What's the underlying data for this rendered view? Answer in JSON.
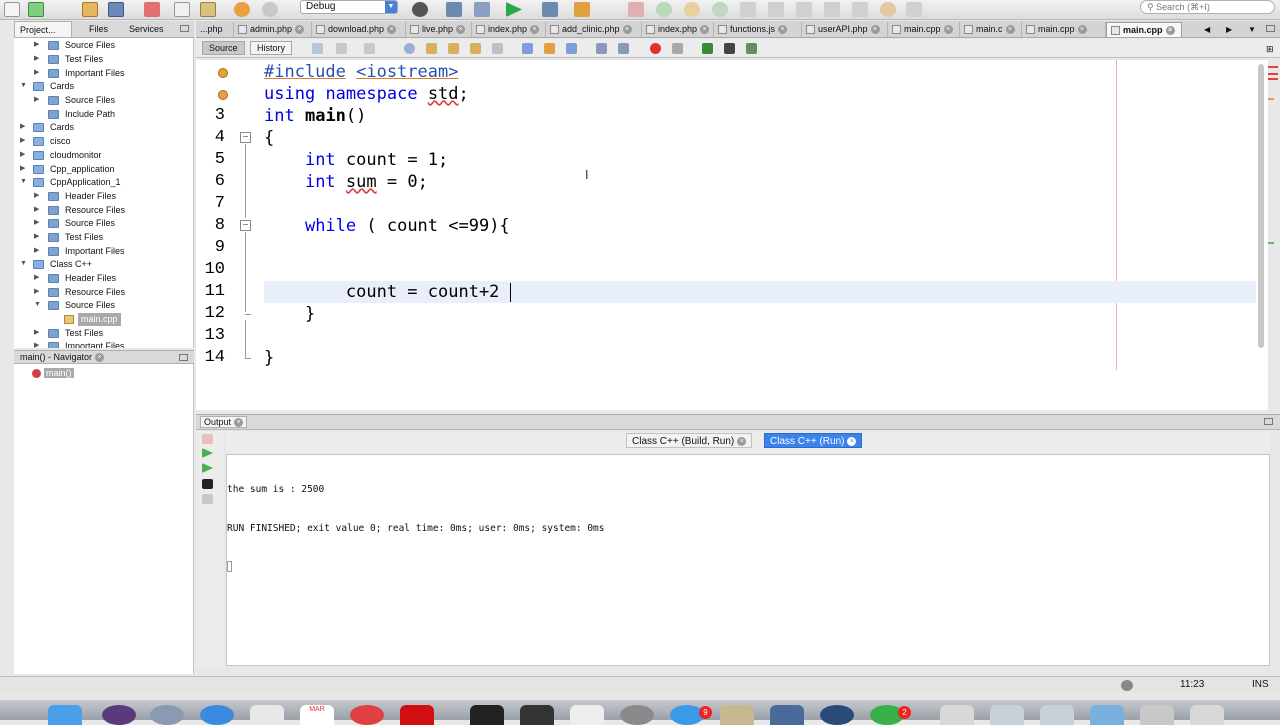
{
  "toolbar": {
    "config": "Debug",
    "search_placeholder": "Search (⌘+I)"
  },
  "projects_panel": {
    "tabs": [
      {
        "label": "Project..."
      },
      {
        "label": "Files"
      },
      {
        "label": "Services"
      }
    ],
    "tree": [
      {
        "label": "Source Files"
      },
      {
        "label": "Test Files"
      },
      {
        "label": "Important Files"
      },
      {
        "label": "Cards"
      },
      {
        "label": "Source Files"
      },
      {
        "label": "Include Path"
      },
      {
        "label": "Cards"
      },
      {
        "label": "cisco"
      },
      {
        "label": "cloudmonitor"
      },
      {
        "label": "Cpp_application"
      },
      {
        "label": "CppApplication_1"
      },
      {
        "label": "Header Files"
      },
      {
        "label": "Resource Files"
      },
      {
        "label": "Source Files"
      },
      {
        "label": "Test Files"
      },
      {
        "label": "Important Files"
      },
      {
        "label": "Class C++"
      },
      {
        "label": "Header Files"
      },
      {
        "label": "Resource Files"
      },
      {
        "label": "Source Files"
      },
      {
        "label": "main.cpp"
      },
      {
        "label": "Test Files"
      },
      {
        "label": "Important Files"
      }
    ]
  },
  "navigator": {
    "title": "main() - Navigator",
    "items": [
      {
        "label": "main()"
      }
    ]
  },
  "editor_tabs": [
    {
      "label": "...php"
    },
    {
      "label": "admin.php"
    },
    {
      "label": "download.php"
    },
    {
      "label": "live.php"
    },
    {
      "label": "index.php"
    },
    {
      "label": "add_clinic.php"
    },
    {
      "label": "index.php"
    },
    {
      "label": "functions.js"
    },
    {
      "label": "userAPI.php"
    },
    {
      "label": "main.cpp"
    },
    {
      "label": "main.c"
    },
    {
      "label": "main.cpp"
    },
    {
      "label": "main.cpp"
    }
  ],
  "editor_toolbar": {
    "source_label": "Source",
    "history_label": "History"
  },
  "editor": {
    "line_numbers": [
      "3",
      "4",
      "5",
      "6",
      "7",
      "8",
      "9",
      "10",
      "11",
      "12",
      "13",
      "14"
    ],
    "code": {
      "l1_directive": "#include",
      "l1_header": "<iostream>",
      "l2_using": "using",
      "l2_namespace": "namespace",
      "l2_std": "std",
      "l2_semicolon": ";",
      "l3_int": "int",
      "l3_main": "main",
      "l3_parens": "()",
      "l4": "{",
      "l5_int": "int",
      "l5_rest": "count = 1;",
      "l6_int": "int",
      "l6_sum": "sum",
      "l6_rest": " = 0;",
      "l8_while": "while",
      "l8_rest": " ( count <=99){",
      "l11": "count = count+2",
      "l12": "}",
      "l14": "}"
    }
  },
  "output": {
    "panel_title": "Output",
    "tabs": [
      {
        "label": "Class C++ (Build, Run)"
      },
      {
        "label": "Class C++ (Run)"
      }
    ],
    "lines": [
      "the sum is : 2500",
      "RUN FINISHED; exit value 0; real time: 0ms; user: 0ms; system: 0ms"
    ]
  },
  "status": {
    "position": "11:23",
    "mode": "INS"
  },
  "dock": {
    "calendar_month": "MAR",
    "badge_a": "9",
    "badge_b": "2"
  },
  "colors": {
    "keyword": "#0000e6",
    "active_output_tab": "#3b82ec",
    "current_line": "#e9effa"
  }
}
